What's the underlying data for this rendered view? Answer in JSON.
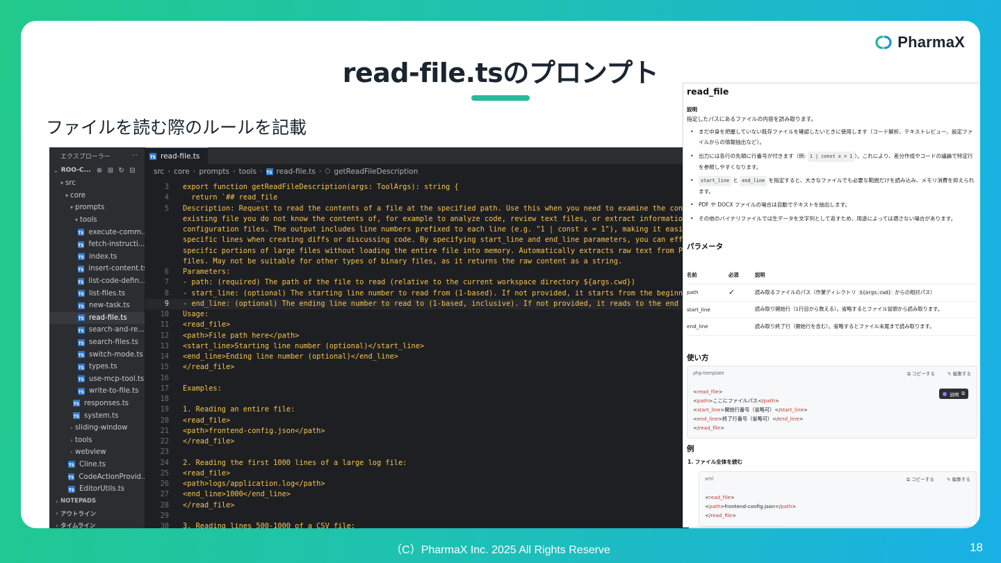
{
  "brand": {
    "name": "PharmaX"
  },
  "slide": {
    "title": "read-file.tsのプロンプト",
    "subtitle": "ファイルを読む際のルールを記載",
    "footer": "（C）PharmaX Inc. 2025  All Rights Reserve",
    "page_number": "18"
  },
  "vscode": {
    "explorer_title": "エクスプローラー",
    "explorer_menu": "···",
    "root_label": "ROO-C...",
    "tree": [
      {
        "label": "src",
        "depth": 1,
        "kind": "folder-open"
      },
      {
        "label": "core",
        "depth": 2,
        "kind": "folder-open"
      },
      {
        "label": "prompts",
        "depth": 3,
        "kind": "folder-open"
      },
      {
        "label": "tools",
        "depth": 4,
        "kind": "folder-open"
      },
      {
        "label": "execute-comm...",
        "depth": 5,
        "kind": "ts"
      },
      {
        "label": "fetch-instructi...",
        "depth": 5,
        "kind": "ts"
      },
      {
        "label": "index.ts",
        "depth": 5,
        "kind": "ts"
      },
      {
        "label": "insert-content.ts",
        "depth": 5,
        "kind": "ts"
      },
      {
        "label": "list-code-defin...",
        "depth": 5,
        "kind": "ts"
      },
      {
        "label": "list-files.ts",
        "depth": 5,
        "kind": "ts"
      },
      {
        "label": "new-task.ts",
        "depth": 5,
        "kind": "ts"
      },
      {
        "label": "read-file.ts",
        "depth": 5,
        "kind": "ts",
        "active": true
      },
      {
        "label": "search-and-re...",
        "depth": 5,
        "kind": "ts"
      },
      {
        "label": "search-files.ts",
        "depth": 5,
        "kind": "ts"
      },
      {
        "label": "switch-mode.ts",
        "depth": 5,
        "kind": "ts"
      },
      {
        "label": "types.ts",
        "depth": 5,
        "kind": "ts"
      },
      {
        "label": "use-mcp-tool.ts",
        "depth": 5,
        "kind": "ts"
      },
      {
        "label": "write-to-file.ts",
        "depth": 5,
        "kind": "ts"
      },
      {
        "label": "responses.ts",
        "depth": 4,
        "kind": "ts"
      },
      {
        "label": "system.ts",
        "depth": 4,
        "kind": "ts"
      },
      {
        "label": "sliding-window",
        "depth": 3,
        "kind": "folder"
      },
      {
        "label": "tools",
        "depth": 3,
        "kind": "folder"
      },
      {
        "label": "webview",
        "depth": 3,
        "kind": "folder"
      },
      {
        "label": "Cline.ts",
        "depth": 3,
        "kind": "ts"
      },
      {
        "label": "CodeActionProvid...",
        "depth": 3,
        "kind": "ts"
      },
      {
        "label": "EditorUtils.ts",
        "depth": 3,
        "kind": "ts"
      },
      {
        "label": "NOTEPADS",
        "depth": 0,
        "kind": "section"
      },
      {
        "label": "アウトライン",
        "depth": 0,
        "kind": "section"
      },
      {
        "label": "タイムライン",
        "depth": 0,
        "kind": "section"
      }
    ],
    "tab_label": "read-file.ts",
    "breadcrumb": [
      "src",
      "core",
      "prompts",
      "tools",
      "read-file.ts",
      "getReadFileDescription"
    ],
    "code_lines": [
      {
        "n": "3",
        "t": "export function getReadFileDescription(args: ToolArgs): string {"
      },
      {
        "n": "4",
        "t": "  return `## read_file"
      },
      {
        "n": "5",
        "t": "Description: Request to read the contents of a file at the specified path. Use this when you need to examine the conte"
      },
      {
        "n": "",
        "t": "existing file you do not know the contents of, for example to analyze code, review text files, or extract information"
      },
      {
        "n": "",
        "t": "configuration files. The output includes line numbers prefixed to each line (e.g. \"1 | const x = 1\"), making it easie"
      },
      {
        "n": "",
        "t": "specific lines when creating diffs or discussing code. By specifying start_line and end_line parameters, you can effi"
      },
      {
        "n": "",
        "t": "specific portions of large files without loading the entire file into memory. Automatically extracts raw text from PD"
      },
      {
        "n": "",
        "t": "files. May not be suitable for other types of binary files, as it returns the raw content as a string."
      },
      {
        "n": "6",
        "t": "Parameters:"
      },
      {
        "n": "7",
        "t": "- path: (required) The path of the file to read (relative to the current workspace directory ${args.cwd})"
      },
      {
        "n": "8",
        "t": "- start_line: (optional) The starting line number to read from (1-based). If not provided, it starts from the beginni"
      },
      {
        "n": "9",
        "t": "- end_line: (optional) The ending line number to read to (1-based, inclusive). If not provided, it reads to the end o",
        "current": true
      },
      {
        "n": "10",
        "t": "Usage:"
      },
      {
        "n": "11",
        "t": "<read_file>"
      },
      {
        "n": "12",
        "t": "<path>File path here</path>"
      },
      {
        "n": "13",
        "t": "<start_line>Starting line number (optional)</start_line>"
      },
      {
        "n": "14",
        "t": "<end_line>Ending line number (optional)</end_line>"
      },
      {
        "n": "15",
        "t": "</read_file>"
      },
      {
        "n": "16",
        "t": ""
      },
      {
        "n": "17",
        "t": "Examples:"
      },
      {
        "n": "18",
        "t": ""
      },
      {
        "n": "19",
        "t": "1. Reading an entire file:"
      },
      {
        "n": "20",
        "t": "<read_file>"
      },
      {
        "n": "21",
        "t": "<path>frontend-config.json</path>"
      },
      {
        "n": "22",
        "t": "</read_file>"
      },
      {
        "n": "23",
        "t": ""
      },
      {
        "n": "24",
        "t": "2. Reading the first 1000 lines of a large log file:"
      },
      {
        "n": "25",
        "t": "<read_file>"
      },
      {
        "n": "26",
        "t": "<path>logs/application.log</path>"
      },
      {
        "n": "27",
        "t": "<end_line>1000</end_line>"
      },
      {
        "n": "28",
        "t": "</read_file>"
      },
      {
        "n": "29",
        "t": ""
      },
      {
        "n": "30",
        "t": "3. Reading lines 500-1000 of a CSV file:"
      }
    ]
  },
  "doc": {
    "title": "read_file",
    "desc_heading": "説明",
    "desc_text": "指定したパスにあるファイルの内容を読み取ります。",
    "bullets": [
      "まだ中身を把握していない既存ファイルを確認したいときに使用します（コード解析、テキストレビュー、設定ファイルからの情報抽出など）。",
      "出力には各行の先頭に行番号が付きます（例: 1 | const x = 1）。これにより、差分作成やコードの議論で特定行を参照しやすくなります。",
      "start_line と end_line を指定すると、大きなファイルでも必要な範囲だけを読み込み、メモリ消費を抑えられます。",
      "PDF や DOCX ファイルの場合は自動でテキストを抽出します。",
      "その他のバイナリファイルでは生データを文字列として返すため、用途によっては適さない場合があります。"
    ],
    "params_heading": "パラメータ",
    "param_headers": [
      "名前",
      "必須",
      "説明"
    ],
    "params": [
      {
        "name": "path",
        "required": "✓",
        "desc": "読み取るファイルのパス（作業ディレクトリ ${args.cwd} からの相対パス）"
      },
      {
        "name": "start_line",
        "required": "",
        "desc": "読み取り開始行（1行目から数える）。省略するとファイル冒頭から読み取ります。"
      },
      {
        "name": "end_line",
        "required": "",
        "desc": "読み取り終了行（開始行を含む）。省略するとファイル末尾まで読み取ります。"
      }
    ],
    "usage_heading": "使い方",
    "usage_lang": "php-template",
    "copy_label": "コピーする",
    "edit_label": "編集する",
    "explain_label": "説明",
    "usage_lines": [
      {
        "open": "read_file",
        "text": "",
        "close": ""
      },
      {
        "open": "path",
        "text": "ここにファイルパス",
        "close": "path"
      },
      {
        "open": "start_line",
        "text": "開始行番号（省略可）",
        "close": "start_line"
      },
      {
        "open": "end_line",
        "text": "終了行番号（省略可）",
        "close": "end_line"
      },
      {
        "open": "",
        "text": "",
        "close": "read_file"
      }
    ],
    "examples_heading": "例",
    "example1_title": "1.  ファイル全体を読む",
    "example1_lang": "xml",
    "example1_lines": [
      {
        "open": "read_file",
        "text": "",
        "close": ""
      },
      {
        "open": "path",
        "text": "frontend-config.json",
        "close": "path"
      },
      {
        "open": "",
        "text": "",
        "close": "read_file"
      }
    ]
  }
}
